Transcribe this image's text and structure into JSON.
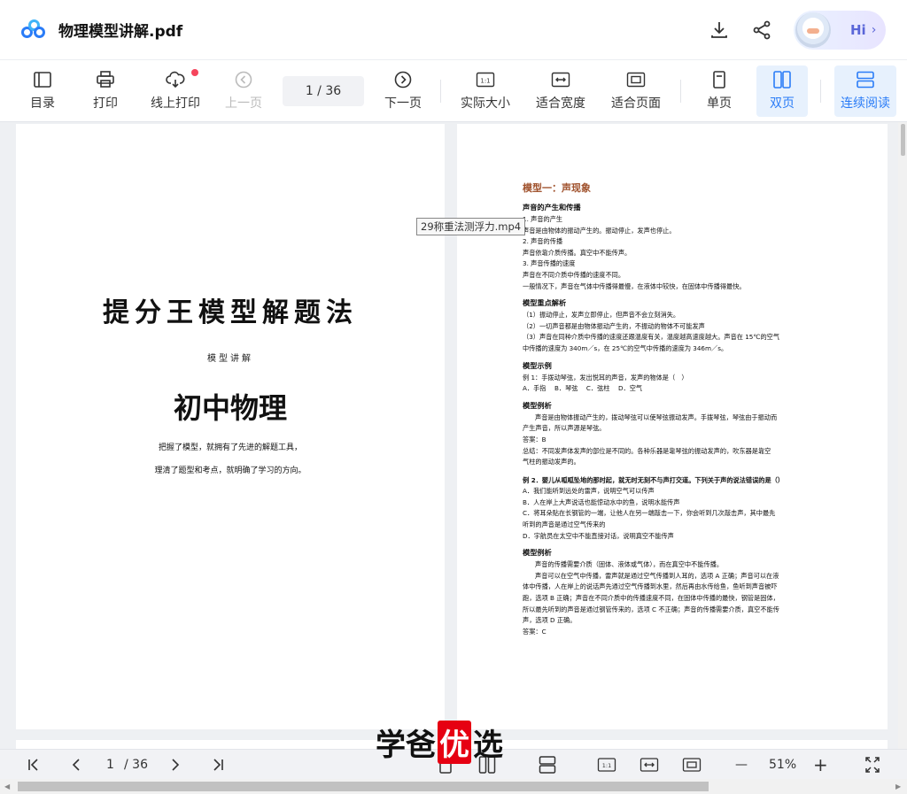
{
  "title_bar": {
    "doc_title": "物理模型讲解.pdf",
    "hi_label": "Hi",
    "hi_chevron": "›"
  },
  "toolbar": {
    "catalog": "目录",
    "print": "打印",
    "online_print": "线上打印",
    "prev_page": "上一页",
    "page_indicator": "1  / 36",
    "next_page": "下一页",
    "actual_size": "实际大小",
    "fit_width": "适合宽度",
    "fit_page": "适合页面",
    "single_page": "单页",
    "double_page": "双页",
    "continuous": "连续阅读",
    "actual_size_glyph": "1:1"
  },
  "tooltip": "29称重法测浮力.mp4",
  "cover": {
    "title": "提分王模型解题法",
    "subtitle": "模型讲解",
    "main": "初中物理",
    "line1": "把握了模型，就拥有了先进的解题工具，",
    "line2": "理清了题型和考点，就明确了学习的方向。"
  },
  "content": {
    "heading": "模型一：声现象",
    "sec1": "声音的产生和传播",
    "lines_a": [
      "1. 声音的产生",
      "声音是由物体的振动产生的。振动停止，发声也停止。",
      "2. 声音的传播",
      "声音依靠介质传播。真空中不能传声。",
      "3. 声音传播的速度",
      "声音在不同介质中传播的速度不同。",
      "一般情况下，声音在气体中传播得最慢，在液体中较快，在固体中传播得最快。"
    ],
    "sec2": "模型重点解析",
    "lines_b": [
      "（1）振动停止，发声立即停止，但声音不会立刻消失。",
      "（2）一切声音都是由物体振动产生的，不振动的物体不可能发声",
      "（3）声音在同种介质中传播的速度还跟温度有关，温度越高速度越大。声音在 15℃的空气",
      "中传播的速度为 340m／s，在 25℃的空气中传播的速度为 346m／s。"
    ],
    "sec3": "模型示例",
    "ex1_q": "例 1：手拨动琴弦，发出悦耳的声音，发声的物体是（　）",
    "ex1_opts": "A．手指　 B．琴弦　 C．弦柱　 D．空气",
    "sec4": "模型例析",
    "ex1_ans_lines": [
      "声音是由物体振动产生的，拨动琴弦可以使琴弦振动发声。手拨琴弦，琴弦由于振动而",
      "产生声音，所以声源是琴弦。"
    ],
    "ex1_answer": "答案：B",
    "ex1_summary": [
      "总结：不同发声体发声的部位是不同的。各种乐器是靠琴弦的振动发声的，吹东器是靠空",
      "气柱的振动发声的。"
    ],
    "ex2_q": "例 2．婴儿从呱呱坠地的那时起，就无时无刻不与声打交道。下列关于声的说法错误的是（）",
    "ex2_opts": [
      "A．我们能听到远处的雷声，说明空气可以传声",
      "B．人在岸上大声说话也能惊动水中的鱼，说明水能传声",
      "C．将耳朵贴在长钢管的一端，让他人在另一端敲击一下，你会听到几次敲击声，其中最先",
      "听到的声音是通过空气传来的",
      "D．宇航员在太空中不能直接对话，说明真空不能传声"
    ],
    "sec5": "模型例析",
    "ex2_ans_lines": [
      "声音的传播需要介质（固体、液体或气体），而在真空中不能传播。",
      "声音可以在空气中传播，雷声就是通过空气传播到人耳的，选项 A 正确；声音可以在液",
      "体中传播，人在岸上的说话声先通过空气传播到水里，然后再由水传给鱼，鱼听到声音被吓",
      "跑，选项 B 正确；声音在不同介质中的传播速度不同，在固体中传播的最快，钢管是固体，",
      "所以最先听到的声音是通过钢管传来的，选项 C 不正确；声音的传播需要介质，真空不能传",
      "声，选项 D 正确。"
    ],
    "ex2_answer": "答案：C"
  },
  "watermark": {
    "left": "学爸",
    "highlight": "优",
    "right": "选"
  },
  "bottom_bar": {
    "page_current": "1",
    "page_total": "/ 36",
    "zoom": "51%",
    "minus": "—",
    "plus": "+"
  },
  "colors": {
    "accent": "#2a7cf7",
    "heading_brown": "#a0522d",
    "badge_red": "#f5455c"
  }
}
